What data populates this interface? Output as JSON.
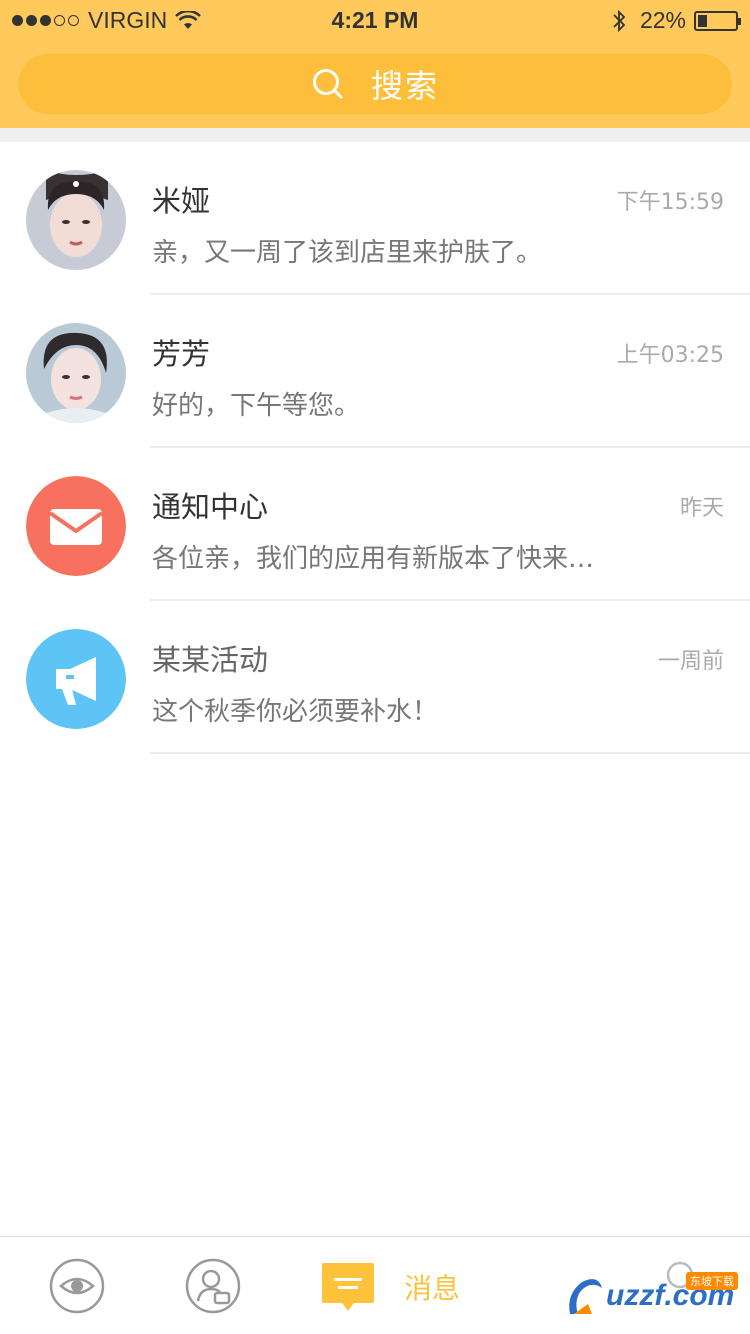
{
  "status_bar": {
    "carrier": "VIRGIN",
    "time": "4:21 PM",
    "battery": "22%",
    "battery_level": 0.22
  },
  "search": {
    "label": "搜索",
    "icon": "search-icon"
  },
  "conversations": [
    {
      "name": "米娅",
      "time": "下午15:59",
      "preview": "亲，又一周了该到店里来护肤了。",
      "avatar": "portrait-photo"
    },
    {
      "name": "芳芳",
      "time": "上午03:25",
      "preview": "好的，下午等您。",
      "avatar": "portrait-photo"
    },
    {
      "name": "通知中心",
      "time": "昨天",
      "preview": "各位亲，我们的应用有新版本了快来…",
      "avatar": "mail-icon",
      "avatar_color": "#f8705e"
    },
    {
      "name": "某某活动",
      "time": "一周前",
      "preview": "这个秋季你必须要补水！",
      "avatar": "megaphone-icon",
      "avatar_color": "#5ec3f5"
    }
  ],
  "tabbar": {
    "active_label": "消息",
    "accent": "#ffc23a",
    "tabs": [
      "eye-icon",
      "contact-icon",
      "message-icon",
      "profile-icon"
    ]
  },
  "watermark": {
    "text": "uzzf.com",
    "badge": "东坡下载"
  },
  "colors": {
    "header": "#ffc95b",
    "search_pill": "#fdbf3b"
  }
}
